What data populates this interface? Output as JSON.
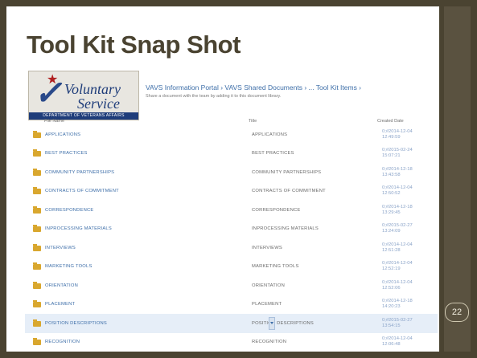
{
  "slide": {
    "title": "Tool Kit Snap Shot",
    "page_number": "22"
  },
  "logo": {
    "line1": "Voluntary",
    "line2": "Service",
    "subtitle": "DEPARTMENT OF VETERANS AFFAIRS"
  },
  "breadcrumb": "VAVS Information Portal › VAVS Shared Documents › ... Tool Kit Items ›",
  "breadcrumb_desc": "Share a document with the team by adding it to this document library.",
  "columns": {
    "name": "File Name",
    "title": "Title",
    "date": "Created Date"
  },
  "rows": [
    {
      "name": "APPLICATIONS",
      "title": "APPLICATIONS",
      "date1": "0;#2014-12-04",
      "date2": "12:49:59"
    },
    {
      "name": "BEST PRACTICES",
      "title": "BEST PRACTICES",
      "date1": "0;#2015-02-24",
      "date2": "15:07:21"
    },
    {
      "name": "COMMUNITY PARTNERSHIPS",
      "title": "COMMUNITY PARTNERSHIPS",
      "date1": "0;#2014-12-18",
      "date2": "13:43:58"
    },
    {
      "name": "CONTRACTS OF COMMITMENT",
      "title": "CONTRACTS OF COMMITMENT",
      "date1": "0;#2014-12-04",
      "date2": "12:50:52"
    },
    {
      "name": "CORRESPONDENCE",
      "title": "CORRESPONDENCE",
      "date1": "0;#2014-12-18",
      "date2": "13:29:45"
    },
    {
      "name": "INPROCESSING MATERIALS",
      "title": "INPROCESSING MATERIALS",
      "date1": "0;#2015-02-27",
      "date2": "13:24:09"
    },
    {
      "name": "INTERVIEWS",
      "title": "INTERVIEWS",
      "date1": "0;#2014-12-04",
      "date2": "12:51:28"
    },
    {
      "name": "MARKETING TOOLS",
      "title": "MARKETING TOOLS",
      "date1": "0;#2014-12-04",
      "date2": "12:52:19"
    },
    {
      "name": "ORIENTATION",
      "title": "ORIENTATION",
      "date1": "0;#2014-12-04",
      "date2": "12:52:06"
    },
    {
      "name": "PLACEMENT",
      "title": "PLACEMENT",
      "date1": "0;#2014-12-18",
      "date2": "14:20:23"
    },
    {
      "name": "POSITION DESCRIPTIONS",
      "title": "POSITION DESCRIPTIONS",
      "date1": "0;#2015-02-27",
      "date2": "13:54:15"
    },
    {
      "name": "RECOGNITION",
      "title": "RECOGNITION",
      "date1": "0;#2014-12-04",
      "date2": "12:06:48"
    }
  ]
}
